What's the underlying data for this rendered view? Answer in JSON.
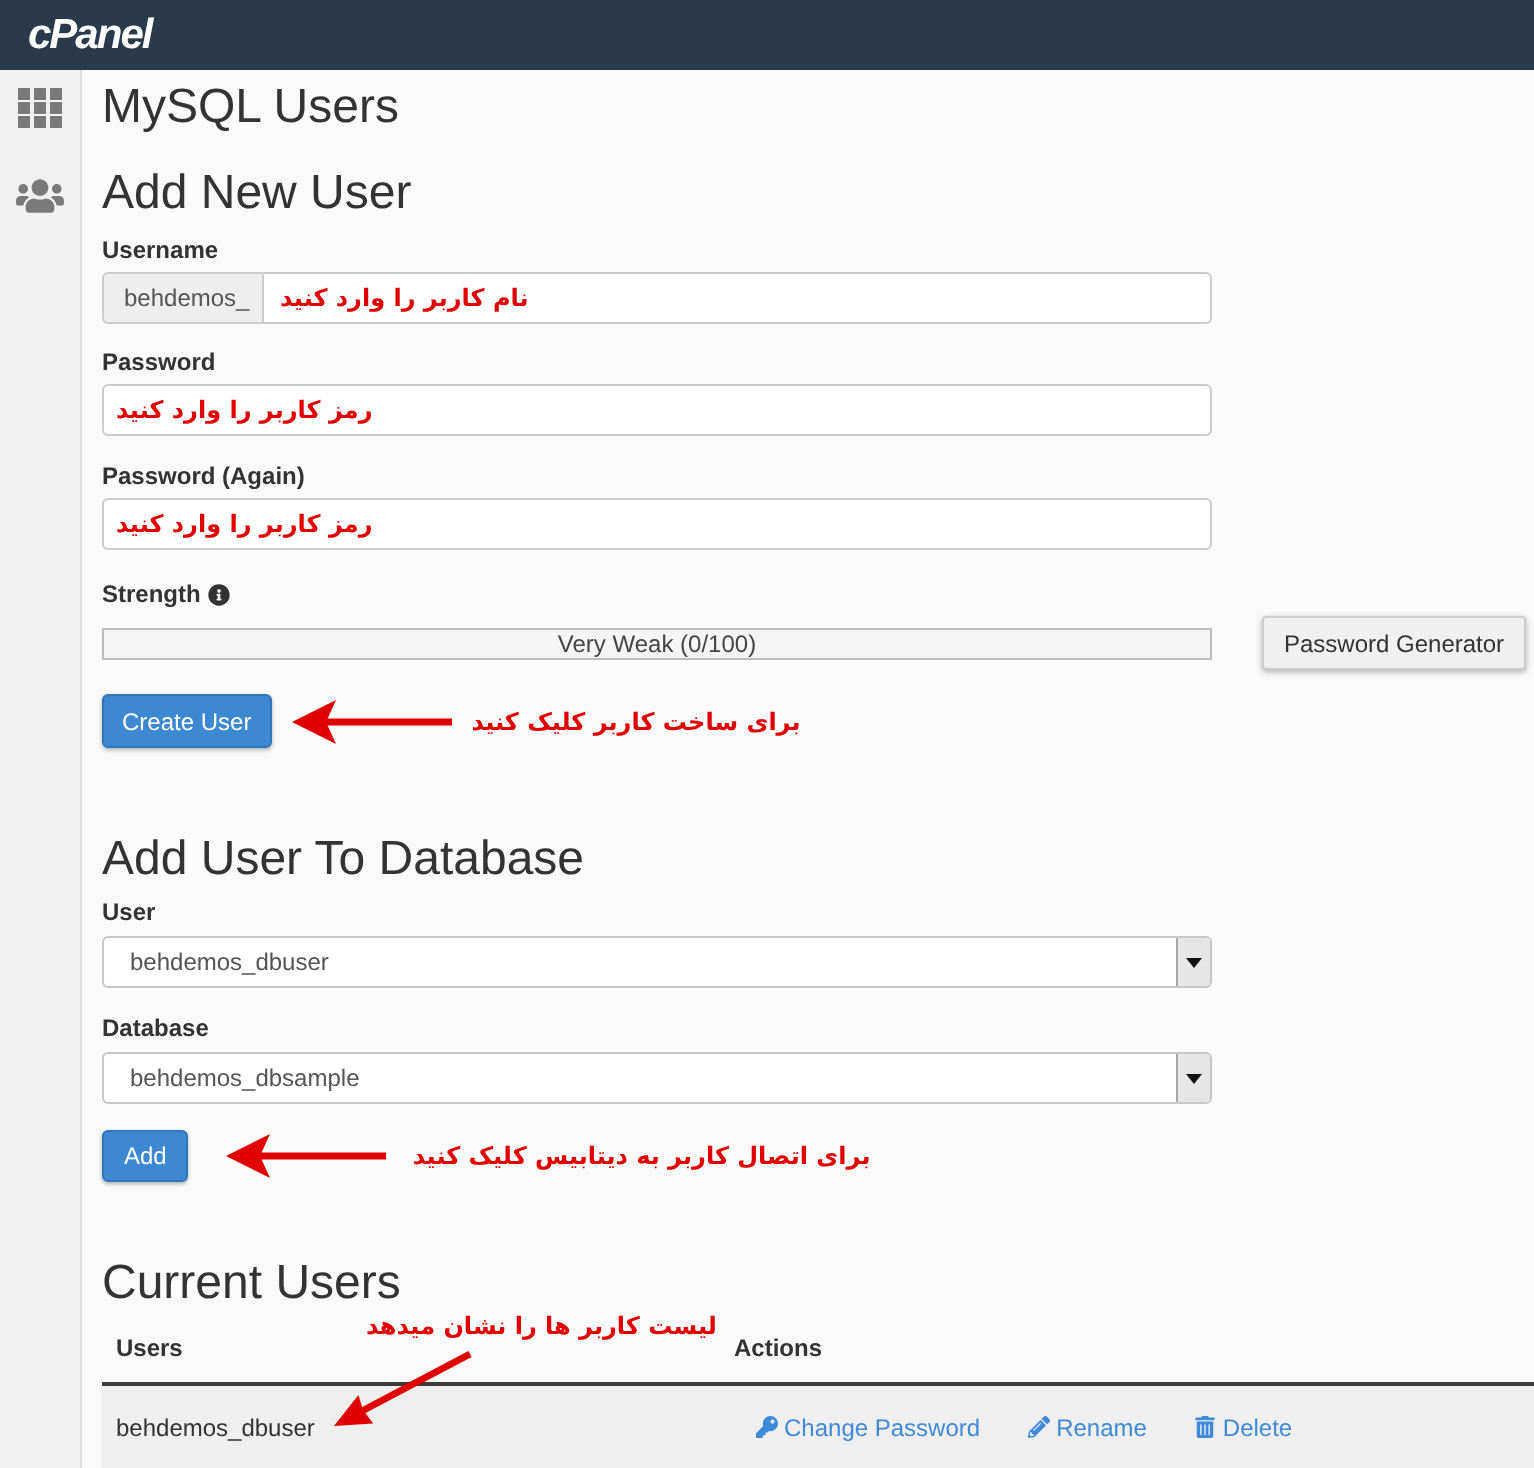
{
  "header": {
    "logo": "cPanel"
  },
  "page_title": "MySQL Users",
  "add_new_user": {
    "title": "Add New User",
    "username": {
      "label": "Username",
      "prefix": "behdemos_",
      "value": "نام کاربر را وارد کنید"
    },
    "password": {
      "label": "Password",
      "value": "رمز کاربر را وارد کنید"
    },
    "password_again": {
      "label": "Password (Again)",
      "value": "رمز کاربر را وارد کنید"
    },
    "strength": {
      "label": "Strength",
      "level": 0,
      "reading": "Very Weak (0/100)"
    },
    "generator_button": "Password Generator",
    "create_button": "Create User",
    "note": "برای ساخت کاربر کلیک کنید"
  },
  "add_user_to_database": {
    "title": "Add User To Database",
    "user": {
      "label": "User",
      "value": "behdemos_dbuser"
    },
    "database": {
      "label": "Database",
      "value": "behdemos_dbsample"
    },
    "add_button": "Add",
    "note": "برای اتصال کاربر به دیتابیس کلیک کنید"
  },
  "current_users": {
    "title": "Current Users",
    "note": "لیست کاربر ها را نشان میدهد",
    "columns": [
      "Users",
      "Actions"
    ],
    "rows": [
      {
        "user": "behdemos_dbuser",
        "actions": [
          {
            "kind": "key",
            "label": "Change Password"
          },
          {
            "kind": "pencil",
            "label": "Rename"
          },
          {
            "kind": "trash",
            "label": "Delete"
          }
        ]
      }
    ]
  }
}
